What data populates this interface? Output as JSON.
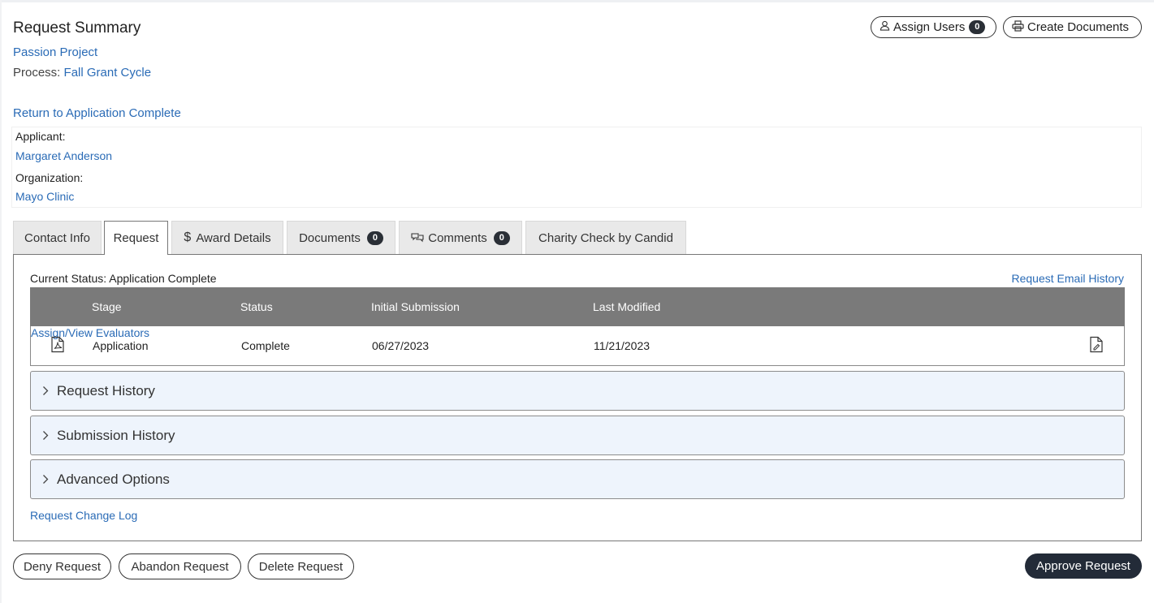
{
  "header": {
    "title": "Request Summary",
    "project": "Passion Project",
    "process_label": "Process:",
    "process_value": "Fall Grant Cycle",
    "return_link": "Return to Application Complete",
    "assign_users": {
      "label": "Assign Users",
      "count": "0",
      "icon": "user-icon"
    },
    "create_documents": {
      "label": "Create Documents",
      "icon": "printer-icon"
    }
  },
  "info": {
    "applicant_label": "Applicant:",
    "applicant": "Margaret Anderson",
    "organization_label": "Organization:",
    "organization": "Mayo Clinic"
  },
  "tabs": [
    {
      "label": "Contact Info"
    },
    {
      "label": "Request",
      "active": true
    },
    {
      "label": "Award Details",
      "icon": "dollar-icon"
    },
    {
      "label": "Documents",
      "count": "0"
    },
    {
      "label": "Comments",
      "count": "0",
      "icon": "comments-icon"
    },
    {
      "label": "Charity Check by Candid"
    }
  ],
  "request": {
    "current_status": "Current Status: Application Complete",
    "email_history": "Request Email History",
    "columns": [
      "Stage",
      "Status",
      "Initial Submission",
      "Last Modified"
    ],
    "row": {
      "stage": "Application",
      "status": "Complete",
      "initial_submission": "06/27/2023",
      "last_modified": "11/21/2023",
      "evaluators_link": "Assign/View Evaluators"
    },
    "accordions": [
      "Request History",
      "Submission History",
      "Advanced Options"
    ],
    "change_log": "Request Change Log"
  },
  "footer": {
    "deny": "Deny Request",
    "abandon": "Abandon Request",
    "delete": "Delete Request",
    "approve": "Approve Request"
  },
  "colors": {
    "link": "#2a6bb6",
    "table_header": "#7a7a7a",
    "accordion_bg": "#eef4fc",
    "primary_button": "#232b38"
  }
}
